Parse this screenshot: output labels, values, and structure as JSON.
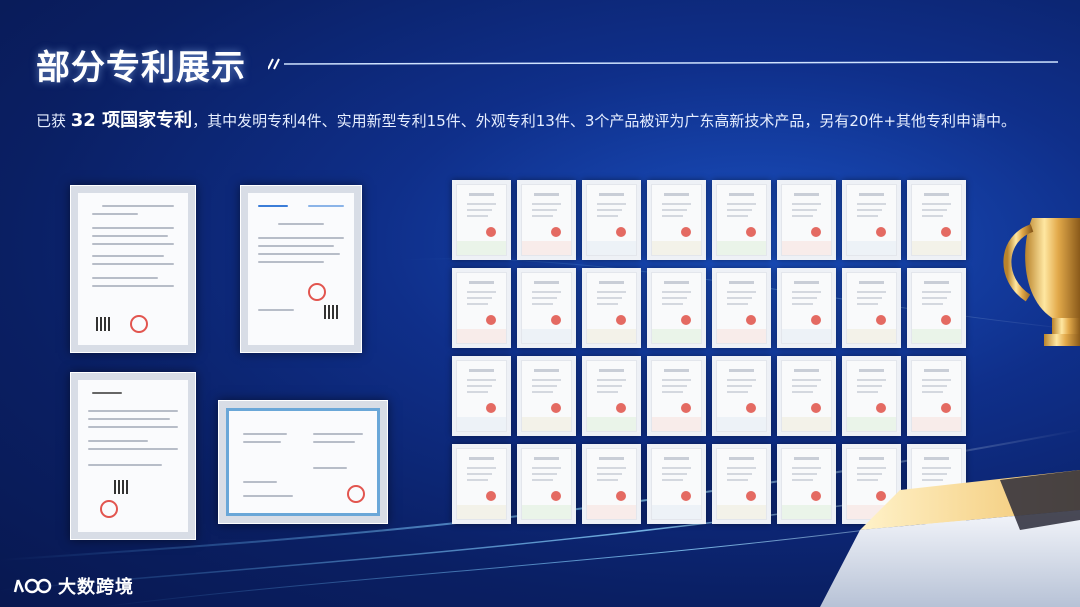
{
  "title": "部分专利展示",
  "description": {
    "prefix": "已获 ",
    "highlight": "32 项国家专利",
    "rest": "，其中发明专利4件、实用新型专利15件、外观专利13件、3个产品被评为广东高新技术产品，另有20件+其他专利申请中。"
  },
  "logo": {
    "text": "大数跨境",
    "icon": "brand-logo-icon"
  },
  "certificate_grid": {
    "rows": 4,
    "columns": 8
  },
  "colors": {
    "background": "#0f2f8a",
    "accent": "#8fd0ff",
    "seal": "#e2554f"
  }
}
